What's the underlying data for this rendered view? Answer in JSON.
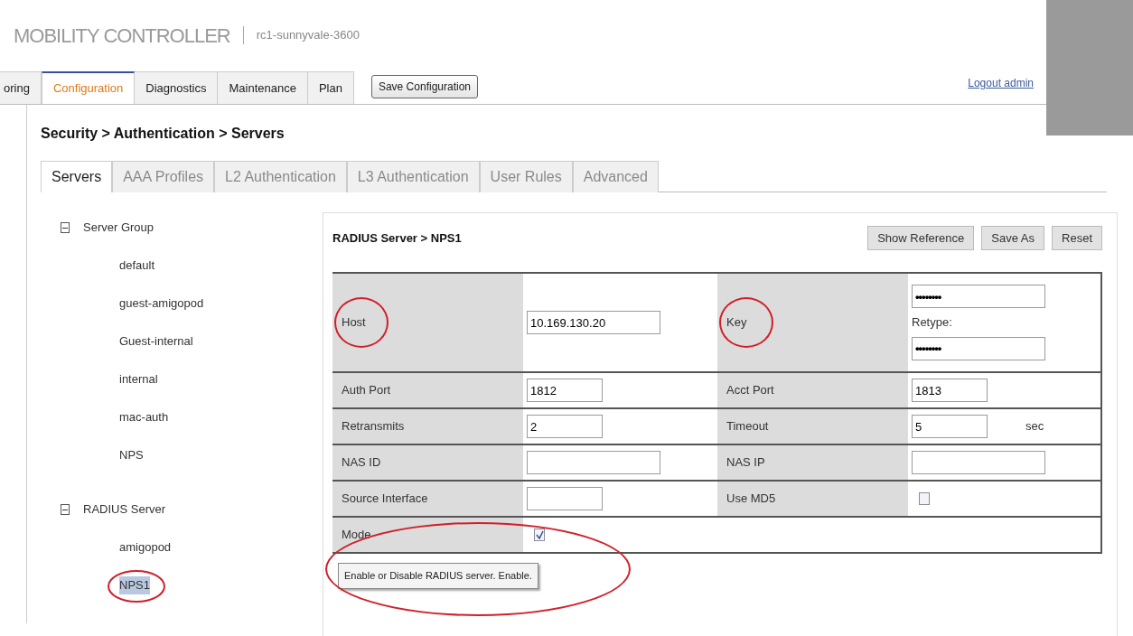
{
  "header": {
    "product": "MOBILITY CONTROLLER",
    "device": "rc1-sunnyvale-3600"
  },
  "top_tabs": [
    {
      "label": "oring",
      "selected": false
    },
    {
      "label": "Configuration",
      "selected": true
    },
    {
      "label": "Diagnostics",
      "selected": false
    },
    {
      "label": "Maintenance",
      "selected": false
    },
    {
      "label": "Plan",
      "selected": false
    }
  ],
  "save_button": "Save Configuration",
  "logout_link": "Logout admin",
  "breadcrumb": "Security > Authentication > Servers",
  "sub_tabs": [
    {
      "label": "Servers",
      "selected": true
    },
    {
      "label": "AAA Profiles",
      "selected": false
    },
    {
      "label": "L2 Authentication",
      "selected": false
    },
    {
      "label": "L3 Authentication",
      "selected": false
    },
    {
      "label": "User Rules",
      "selected": false
    },
    {
      "label": "Advanced",
      "selected": false
    }
  ],
  "tree": [
    {
      "label": "Server Group",
      "expanded": true,
      "children": [
        {
          "label": "default",
          "selected": false,
          "circled": false
        },
        {
          "label": "guest-amigopod",
          "selected": false,
          "circled": false
        },
        {
          "label": "Guest-internal",
          "selected": false,
          "circled": false
        },
        {
          "label": "internal",
          "selected": false,
          "circled": false
        },
        {
          "label": "mac-auth",
          "selected": false,
          "circled": false
        },
        {
          "label": "NPS",
          "selected": false,
          "circled": false
        }
      ]
    },
    {
      "label": "RADIUS Server",
      "expanded": true,
      "children": [
        {
          "label": "amigopod",
          "selected": false,
          "circled": false
        },
        {
          "label": "NPS1",
          "selected": true,
          "circled": true
        }
      ]
    }
  ],
  "panel": {
    "title": "RADIUS Server > NPS1",
    "buttons": [
      "Show Reference",
      "Save As",
      "Reset"
    ],
    "rows": [
      {
        "cells": [
          {
            "label": "Host",
            "circled": true,
            "kind": "field",
            "value": "10.169.130.20"
          },
          {
            "label": "Key",
            "circled": true,
            "kind": "key",
            "value": "••••••••",
            "retype_label": "Retype:",
            "retype_value": "••••••••"
          }
        ]
      },
      {
        "cells": [
          {
            "label": "Auth Port",
            "circled": false,
            "kind": "short_field",
            "value": "1812"
          },
          {
            "label": "Acct Port",
            "circled": false,
            "kind": "short_field",
            "value": "1813"
          }
        ]
      },
      {
        "cells": [
          {
            "label": "Retransmits",
            "circled": false,
            "kind": "short_field",
            "value": "2"
          },
          {
            "label": "Timeout",
            "circled": false,
            "kind": "short_field",
            "value": "5",
            "unit": "sec"
          }
        ]
      },
      {
        "cells": [
          {
            "label": "NAS ID",
            "circled": false,
            "kind": "field"
          },
          {
            "label": "NAS IP",
            "circled": false,
            "kind": "field"
          }
        ]
      },
      {
        "cells": [
          {
            "label": "Source Interface",
            "circled": false,
            "kind": "short_field"
          },
          {
            "label": "Use MD5",
            "circled": false,
            "kind": "checkbox",
            "checked": false
          }
        ]
      },
      {
        "cells": [
          {
            "label": "Mode",
            "circled": false,
            "kind": "checkbox",
            "checked": true
          }
        ]
      }
    ],
    "tooltip": {
      "text": "Enable or Disable RADIUS server. Enable.",
      "circled": true
    }
  }
}
